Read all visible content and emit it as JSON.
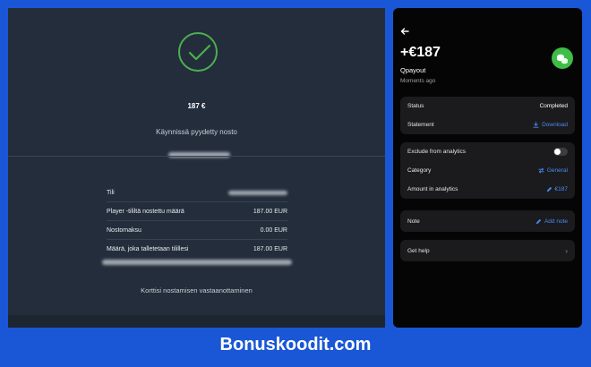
{
  "left": {
    "amount": "187 €",
    "status": "Käynnissä pyydetty nosto",
    "rows": [
      {
        "label": "Tili",
        "value": ""
      },
      {
        "label": "Player -tililtä nostettu määrä",
        "value": "187.00 EUR"
      },
      {
        "label": "Nostomaksu",
        "value": "0.00 EUR"
      },
      {
        "label": "Määrä, joka talletetaan tilillesi",
        "value": "187.00 EUR"
      }
    ],
    "receipt_text": "Korttisi nostamisen vastaanottaminen"
  },
  "right": {
    "amount": "+€187",
    "merchant": "Qpayout",
    "time": "Moments ago",
    "status_label": "Status",
    "status_value": "Completed",
    "statement_label": "Statement",
    "download_label": "Download",
    "exclude_label": "Exclude from analytics",
    "exclude_on": false,
    "category_label": "Category",
    "category_value": "General",
    "amount_analytics_label": "Amount in analytics",
    "amount_analytics_value": "€187",
    "note_label": "Note",
    "add_note_label": "Add note",
    "help_label": "Get help"
  },
  "brand": "Bonuskoodit.com",
  "colors": {
    "accent_blue": "#4a8bf5",
    "success_green": "#4caf50",
    "background": "#1a57d6"
  }
}
